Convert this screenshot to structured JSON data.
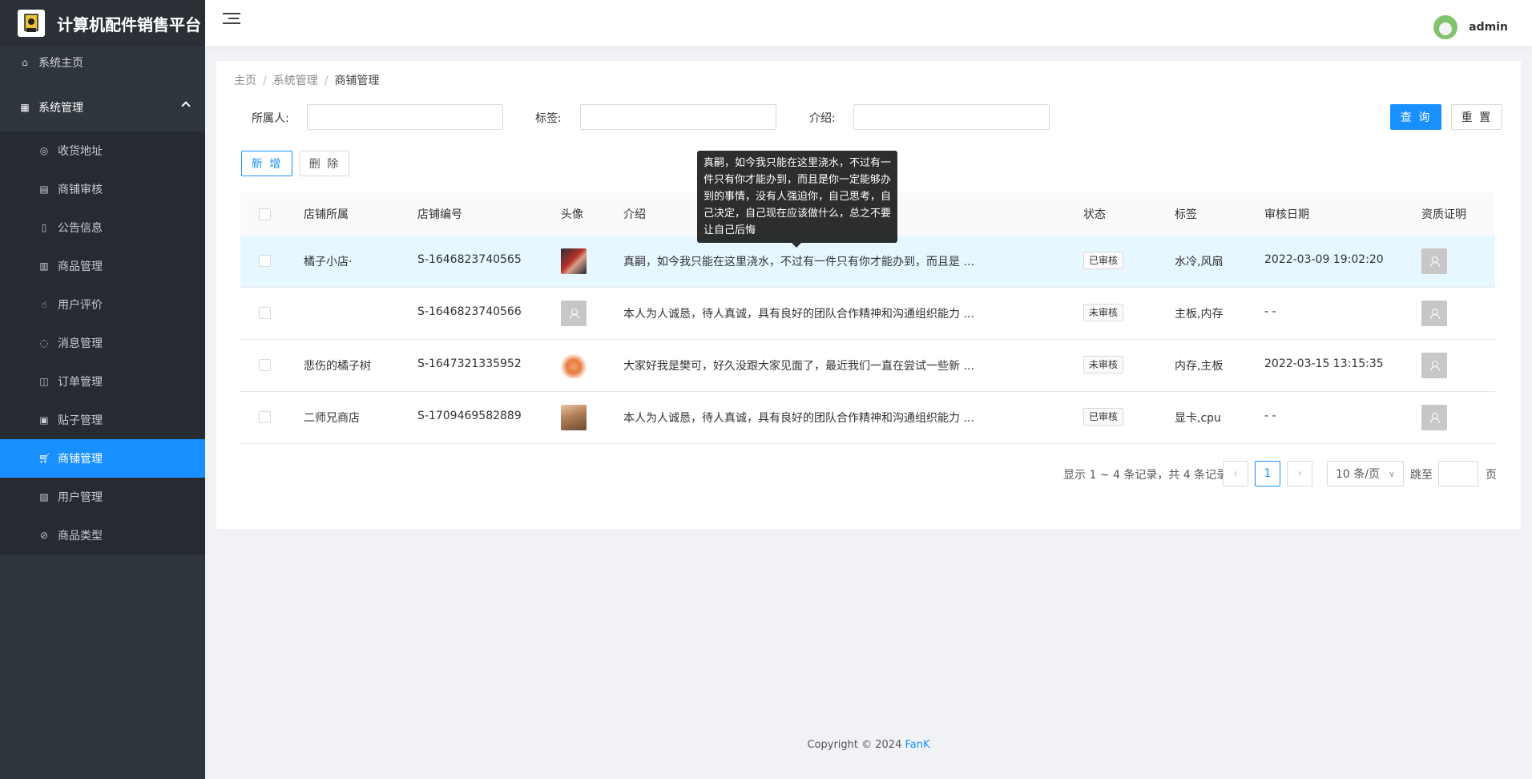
{
  "app": {
    "title": "计算机配件销售平台"
  },
  "sidebar": {
    "home": "系统主页",
    "group": "系统管理",
    "items": [
      {
        "label": "收货地址",
        "icon": "location-icon"
      },
      {
        "label": "商铺审核",
        "icon": "audit-icon"
      },
      {
        "label": "公告信息",
        "icon": "notice-icon"
      },
      {
        "label": "商品管理",
        "icon": "goods-icon"
      },
      {
        "label": "用户评价",
        "icon": "thumb-up-icon"
      },
      {
        "label": "消息管理",
        "icon": "message-icon"
      },
      {
        "label": "订单管理",
        "icon": "order-icon"
      },
      {
        "label": "贴子管理",
        "icon": "post-icon"
      },
      {
        "label": "商铺管理",
        "icon": "cart-icon",
        "active": true
      },
      {
        "label": "用户管理",
        "icon": "user-icon"
      },
      {
        "label": "商品类型",
        "icon": "tag-icon"
      }
    ]
  },
  "header": {
    "username": "admin"
  },
  "breadcrumb": {
    "home": "主页",
    "level1": "系统管理",
    "current": "商铺管理"
  },
  "search": {
    "owner_label": "所属人:",
    "tag_label": "标签:",
    "intro_label": "介绍:",
    "owner_value": "",
    "tag_value": "",
    "intro_value": "",
    "query_btn": "查 询",
    "reset_btn": "重 置"
  },
  "actions": {
    "add_btn": "新 增",
    "delete_btn": "删 除"
  },
  "table": {
    "columns": [
      "店铺所属",
      "店铺编号",
      "头像",
      "介绍",
      "状态",
      "标签",
      "审核日期",
      "资质证明"
    ],
    "rows": [
      {
        "owner": "橘子小店·",
        "code": "S-1646823740565",
        "intro": "真嗣，如今我只能在这里浇水，不过有一件只有你才能办到，而且是 ...",
        "status": "已审核",
        "tags": "水冷,风扇",
        "date": "2022-03-09 19:02:20",
        "avatar": "photo-red"
      },
      {
        "owner": "",
        "code": "S-1646823740566",
        "intro": "本人为人诚恳，待人真诚，具有良好的团队合作精神和沟通组织能力 ...",
        "status": "未审核",
        "tags": "主板,内存",
        "date": "- -",
        "avatar": "placeholder"
      },
      {
        "owner": "悲伤的橘子树",
        "code": "S-1647321335952",
        "intro": "大家好我是樊可，好久没跟大家见面了，最近我们一直在尝试一些新 ...",
        "status": "未审核",
        "tags": "内存,主板",
        "date": "2022-03-15 13:15:35",
        "avatar": "photo-peach"
      },
      {
        "owner": "二师兄商店",
        "code": "S-1709469582889",
        "intro": "本人为人诚恳，待人真诚，具有良好的团队合作精神和沟通组织能力 ...",
        "status": "已审核",
        "tags": "显卡,cpu",
        "date": "- -",
        "avatar": "photo-girl"
      }
    ]
  },
  "tooltip": {
    "text": "真嗣，如今我只能在这里浇水，不过有一件只有你才能办到，而且是你一定能够办到的事情，没有人强迫你，自己思考，自己决定，自己现在应该做什么，总之不要让自己后悔"
  },
  "pagination": {
    "summary": "显示 1 ~ 4 条记录，共 4 条记录",
    "current_page": "1",
    "page_size": "10 条/页",
    "jump_label": "跳至",
    "page_suffix": "页"
  },
  "footer": {
    "prefix": "Copyright © 2024 ",
    "brand": "FanK"
  },
  "colors": {
    "sidebar": "#2f353d",
    "accent": "#1890ff",
    "hover_row": "#e6f7ff"
  }
}
